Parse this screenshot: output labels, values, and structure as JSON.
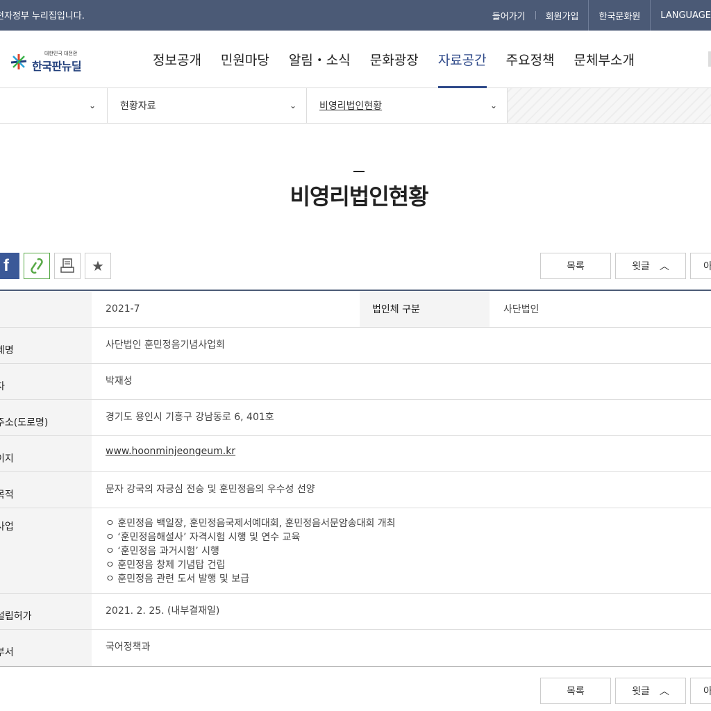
{
  "topbar": {
    "gov_text": "전자정부 누리집입니다.",
    "login": "들어가기",
    "signup": "회원가입",
    "kcci": "한국문화원",
    "language": "LANGUAGE"
  },
  "logo": {
    "small": "대한민국 대전환",
    "big": "한국판뉴딜"
  },
  "gnb": [
    "정보공개",
    "민원마당",
    "알림・소식",
    "문화광장",
    "자료공간",
    "주요정책",
    "문체부소개"
  ],
  "gnb_active": "자료공간",
  "breadcrumb": {
    "level2": "현황자료",
    "level3": "비영리법인현황"
  },
  "page_title": "비영리법인현황",
  "buttons": {
    "list": "목록",
    "prev": "윗글",
    "next": "아랫글",
    "next_visible": "아"
  },
  "table": {
    "row0": {
      "value": "2021-7",
      "label2": "법인체 구분",
      "value2": "사단법인"
    },
    "rows": [
      {
        "label": "법인체명",
        "label_visible": "체명",
        "value": "사단법인 훈민정음기념사업회"
      },
      {
        "label": "대표자",
        "label_visible": "자",
        "value": "박재성"
      },
      {
        "label": "주소(도로명)",
        "label_visible": "주소(도로명)",
        "value": "경기도 용인시 기흥구 강남동로 6, 401호"
      },
      {
        "label": "홈페이지",
        "label_visible": "이지",
        "value": "www.hoonminjeongeum.kr",
        "link": true
      },
      {
        "label": "설립목적",
        "label_visible": "목적",
        "value": "문자 강국의 자긍심 전승 및 훈민정음의 우수성 선양"
      }
    ],
    "business": {
      "label": "주요사업",
      "label_visible": "사업",
      "items": [
        "ㅇ 훈민정음 백일장, 훈민정음국제서예대회, 훈민정음서문암송대회 개최",
        "ㅇ ‘훈민정음해설사’ 자격시험 시행 및 연수 교육",
        "ㅇ ‘훈민정음 과거시험’ 시행",
        "ㅇ 훈민정음 창제 기념탑 건립",
        "ㅇ 훈민정음 관련 도서 발행 및 보급"
      ]
    },
    "rows2": [
      {
        "label": "설립허가",
        "label_visible": "설립허가",
        "value": "2021. 2. 25. (내부결재일)"
      },
      {
        "label": "담당부서",
        "label_visible": "부서",
        "value": "국어정책과"
      }
    ]
  },
  "colors": {
    "topbar": "#4b5a76",
    "accent": "#2f4a8a",
    "facebook": "#3b5998",
    "link_green": "#56a845"
  }
}
